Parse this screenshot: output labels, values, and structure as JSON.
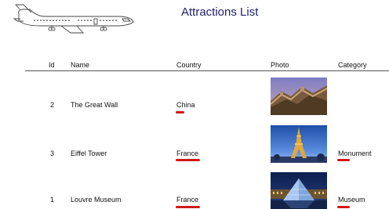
{
  "header": {
    "title": "Attractions List",
    "logo_icon": "airplane-logo-icon"
  },
  "table": {
    "columns": {
      "id": "Id",
      "name": "Name",
      "country": "Country",
      "photo": "Photo",
      "category": "Category"
    },
    "rows": [
      {
        "id": "2",
        "name": "The Great Wall",
        "country": "China",
        "category": "",
        "photo_icon": "great-wall-photo"
      },
      {
        "id": "3",
        "name": "Eiffel Tower",
        "country": "France",
        "category": "Monument",
        "photo_icon": "eiffel-tower-photo"
      },
      {
        "id": "1",
        "name": "Louvre Museum",
        "country": "France",
        "category": "Museum",
        "photo_icon": "louvre-pyramid-photo"
      }
    ]
  },
  "colors": {
    "title": "#1f1f6e",
    "annotation_mark": "#d41616",
    "rule": "#555555"
  }
}
